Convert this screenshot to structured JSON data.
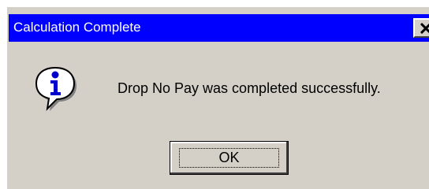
{
  "window": {
    "title": "Calculation Complete",
    "close_icon": "close-x-icon"
  },
  "dialog": {
    "icon": "information-icon",
    "message": "Drop No Pay was completed successfully.",
    "ok_label": "OK"
  },
  "colors": {
    "titlebar": "#0000ff",
    "title_text": "#ffffff",
    "dialog_bg": "#d4d0c8"
  }
}
